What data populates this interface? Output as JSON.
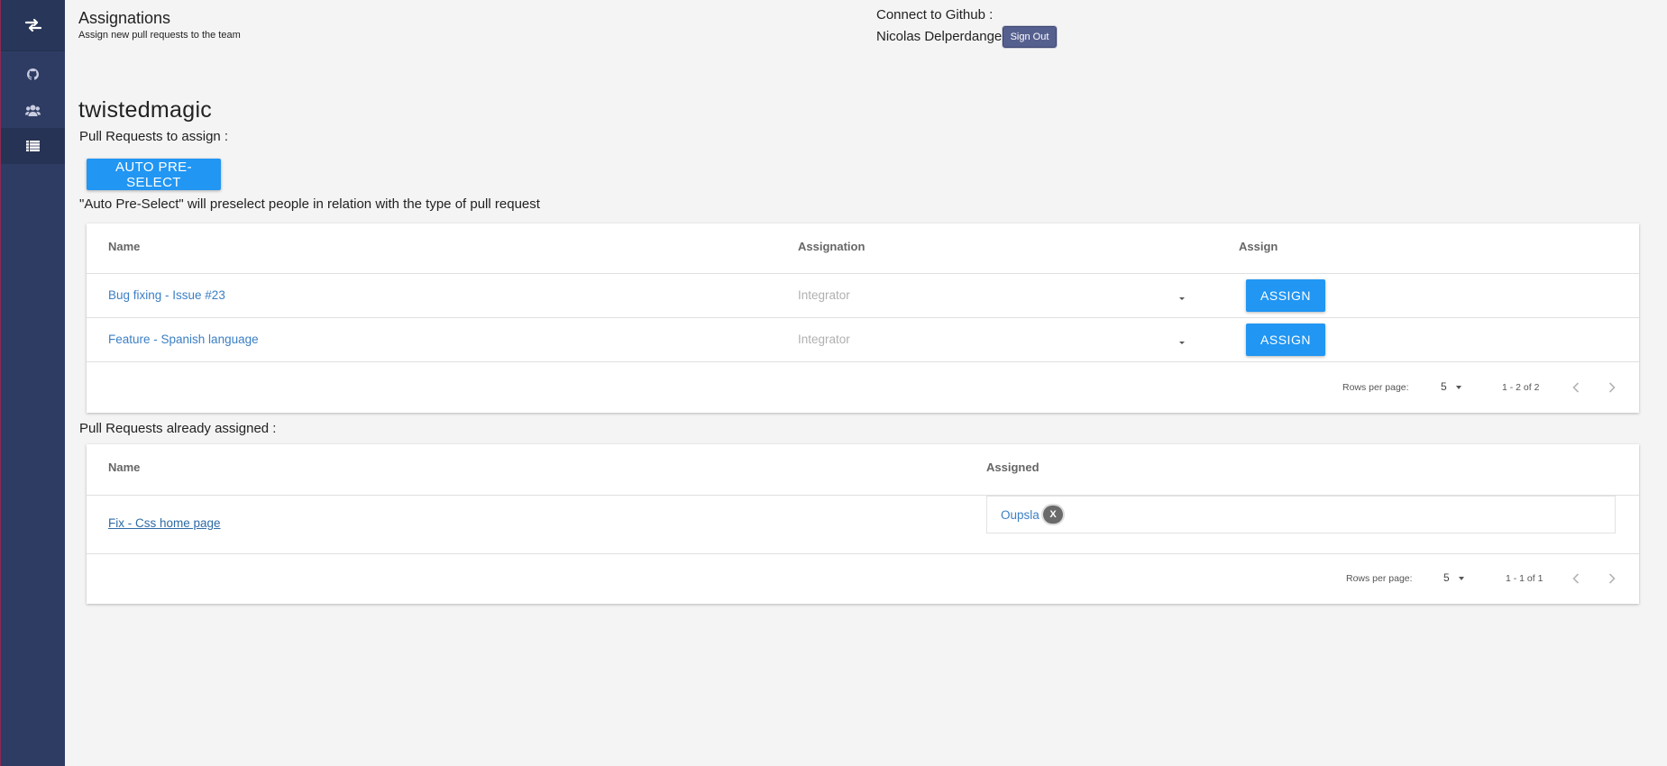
{
  "header": {
    "title": "Assignations",
    "subtitle": "Assign new pull requests to the team",
    "github_label": "Connect to Github :",
    "user_name": "Nicolas Delperdange",
    "signout_label": "Sign Out"
  },
  "sidebar": {
    "logo_icon": "swap-arrows-icon",
    "items": [
      {
        "icon": "github-icon",
        "active": false
      },
      {
        "icon": "users-icon",
        "active": false
      },
      {
        "icon": "list-icon",
        "active": true
      }
    ]
  },
  "org_name": "twistedmagic",
  "to_assign": {
    "section_label": "Pull Requests to assign :",
    "auto_button": "AUTO PRE-SELECT",
    "hint": "\"Auto Pre-Select\" will preselect people in relation with the type of pull request",
    "columns": [
      "Name",
      "Assignation",
      "Assign"
    ],
    "rows": [
      {
        "name": "Bug fixing - Issue #23",
        "assignation_placeholder": "Integrator",
        "button": "ASSIGN"
      },
      {
        "name": "Feature - Spanish language",
        "assignation_placeholder": "Integrator",
        "button": "ASSIGN"
      }
    ],
    "footer": {
      "rows_per_page_label": "Rows per page:",
      "rows_per_page": "5",
      "range": "1 - 2 of 2"
    }
  },
  "assigned": {
    "section_label": "Pull Requests already assigned :",
    "columns": [
      "Name",
      "Assigned"
    ],
    "rows": [
      {
        "name": "Fix - Css home page",
        "assignee": "Oupsla",
        "remove_label": "X"
      }
    ],
    "footer": {
      "rows_per_page_label": "Rows per page:",
      "rows_per_page": "5",
      "range": "1 - 1 of 1"
    }
  },
  "colors": {
    "sidebar": "#2e3c64",
    "primary_button": "#2196f3",
    "link": "#3b7fc4",
    "signout": "#56608f"
  }
}
